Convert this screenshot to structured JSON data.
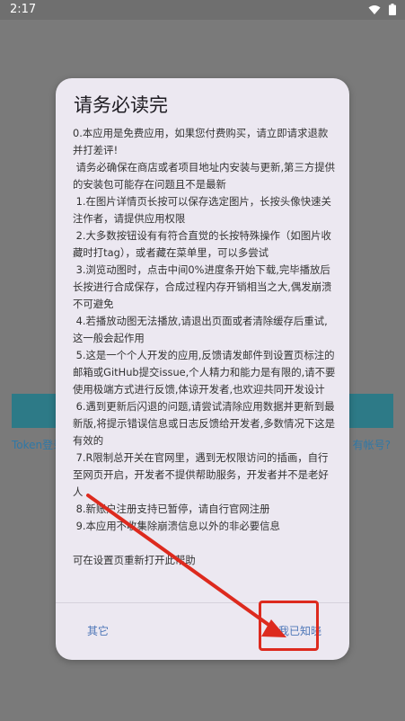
{
  "status_bar": {
    "time": "2:17",
    "wifi_icon": "wifi-icon",
    "battery_icon": "battery-icon"
  },
  "background": {
    "left_link": "Token登录",
    "right_link": "有帐号?"
  },
  "dialog": {
    "title": "请务必读完",
    "paragraphs": [
      "0.本应用是免费应用，如果您付费购买，请立即请求退款并打差评!",
      " 请务必确保在商店或者项目地址内安装与更新,第三方提供的安装包可能存在问题且不是最新",
      " 1.在图片详情页长按可以保存选定图片，长按头像快速关注作者，请提供应用权限",
      " 2.大多数按钮设有有符合直觉的长按特殊操作（如图片收藏时打tag），或者藏在菜单里，可以多尝试",
      " 3.浏览动图时，点击中间0%进度条开始下载,完毕播放后长按进行合成保存，合成过程内存开销相当之大,偶发崩溃不可避免",
      " 4.若播放动图无法播放,请退出页面或者清除缓存后重试,这一般会起作用",
      " 5.这是一个个人开发的应用,反馈请发邮件到设置页标注的邮箱或GitHub提交issue,个人精力和能力是有限的,请不要使用极端方式进行反馈,体谅开发者,也欢迎共同开发设计",
      " 6.遇到更新后闪退的问题,请尝试清除应用数据并更新到最新版,将提示错误信息或日志反馈给开发者,多数情况下这是有效的",
      " 7.R限制总开关在官网里，遇到无权限访问的插画，自行至网页开启，开发者不提供帮助服务，开发者并不是老好人",
      " 8.新账户注册支持已暂停，请自行官网注册",
      " 9.本应用不收集除崩溃信息以外的非必要信息",
      "",
      "可在设置页重新打开此帮助"
    ],
    "buttons": {
      "other": "其它",
      "ok": "我已知晓"
    }
  }
}
